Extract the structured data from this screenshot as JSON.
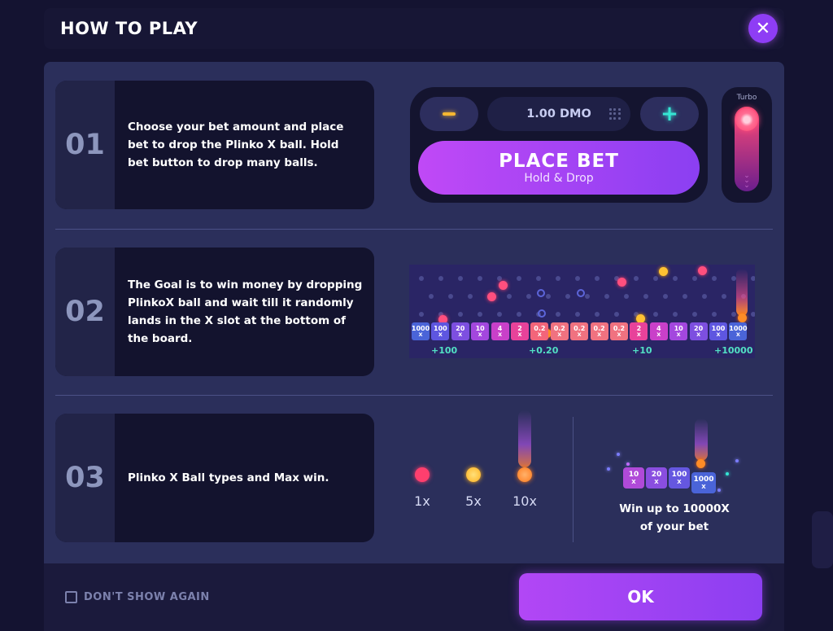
{
  "dialog": {
    "title": "HOW TO PLAY",
    "close_icon": "close-icon",
    "close_glyph": "✕"
  },
  "steps": [
    {
      "number": "01",
      "text": "Choose your bet amount and place bet to drop the Plinko X ball. Hold bet button to drop many balls."
    },
    {
      "number": "02",
      "text": "The Goal is to win money by dropping PlinkoX ball and wait till it randomly lands in the X slot at the bottom of the board."
    },
    {
      "number": "03",
      "text": "Plinko X Ball types and Max win."
    }
  ],
  "bet_panel": {
    "amount": "1.00 DMO",
    "minus_icon": "minus-icon",
    "plus_glyph": "+",
    "place_bet_label": "PLACE BET",
    "place_bet_sub": "Hold & Drop",
    "turbo_label": "Turbo",
    "turbo_arrows": "⌄⌄⌄"
  },
  "board": {
    "slots": [
      {
        "value": "1000",
        "unit": "X",
        "color": "#4a64d8"
      },
      {
        "value": "100",
        "unit": "X",
        "color": "#5e56e0"
      },
      {
        "value": "20",
        "unit": "X",
        "color": "#7d4fe0"
      },
      {
        "value": "10",
        "unit": "X",
        "color": "#a347de"
      },
      {
        "value": "4",
        "unit": "X",
        "color": "#c940c9"
      },
      {
        "value": "2",
        "unit": "X",
        "color": "#e8429a"
      },
      {
        "value": "0.2",
        "unit": "X",
        "color": "#f3657a"
      },
      {
        "value": "0.2",
        "unit": "X",
        "color": "#f07280"
      },
      {
        "value": "0.2",
        "unit": "X",
        "color": "#f07280"
      },
      {
        "value": "0.2",
        "unit": "X",
        "color": "#f07280"
      },
      {
        "value": "0.2",
        "unit": "X",
        "color": "#f07280"
      },
      {
        "value": "2",
        "unit": "X",
        "color": "#e8429a"
      },
      {
        "value": "4",
        "unit": "X",
        "color": "#c940c9"
      },
      {
        "value": "10",
        "unit": "X",
        "color": "#a347de"
      },
      {
        "value": "20",
        "unit": "X",
        "color": "#7d4fe0"
      },
      {
        "value": "100",
        "unit": "X",
        "color": "#5e56e0"
      },
      {
        "value": "1000",
        "unit": "X",
        "color": "#4a64d8"
      }
    ],
    "win_labels": [
      "+100",
      "+0.20",
      "+10",
      "+10000"
    ]
  },
  "ball_types": [
    {
      "multiplier": "1x",
      "color": "#ff3f6e"
    },
    {
      "multiplier": "5x",
      "color": "#ffb11f"
    },
    {
      "multiplier": "10x",
      "color": "#ff7a1c"
    }
  ],
  "max_win": {
    "slots": [
      {
        "value": "10",
        "unit": "X",
        "color": "#b04ad8"
      },
      {
        "value": "20",
        "unit": "X",
        "color": "#8a4ee0"
      },
      {
        "value": "100",
        "unit": "X",
        "color": "#6557e0"
      },
      {
        "value": "1000",
        "unit": "X",
        "color": "#4a64d8"
      }
    ],
    "line1": "Win up to 10000X",
    "line2": "of your bet"
  },
  "footer": {
    "dont_show_label": "DON'T SHOW AGAIN",
    "dont_show_checked": false,
    "ok_label": "OK"
  }
}
